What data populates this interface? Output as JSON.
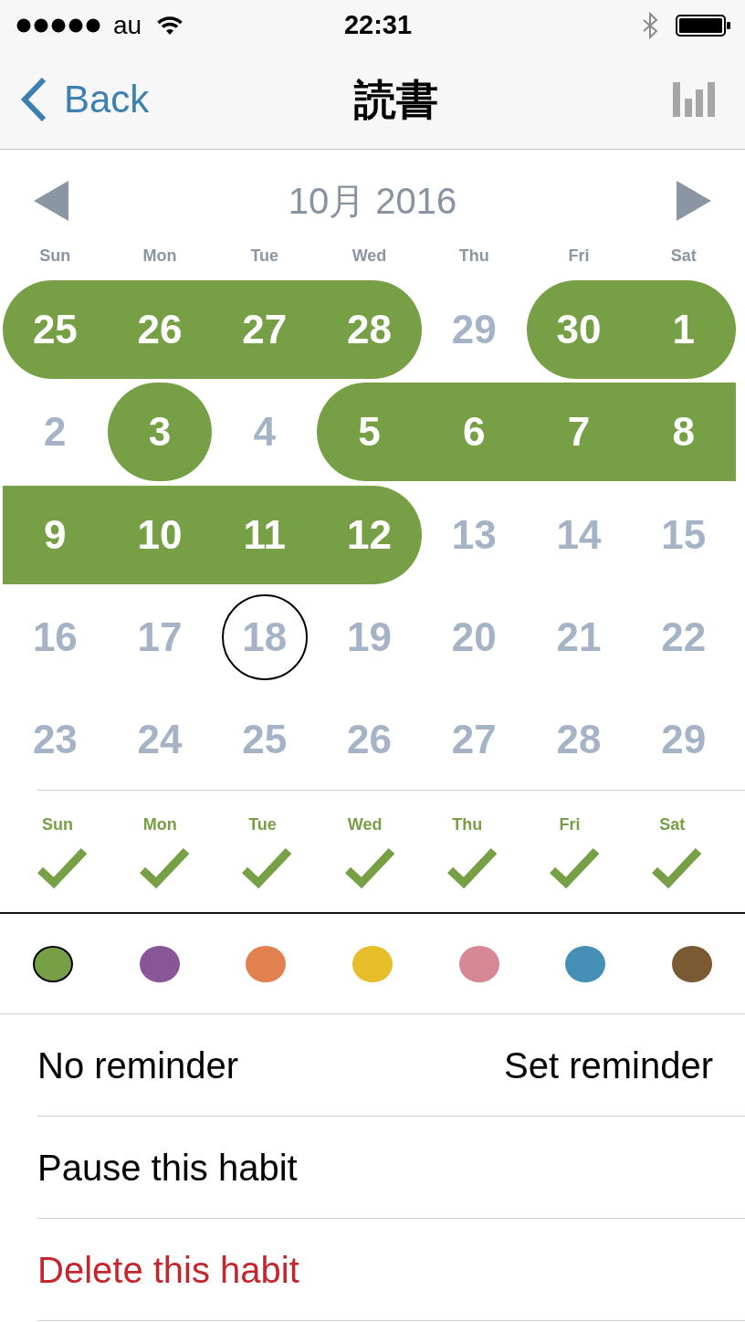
{
  "status_bar": {
    "carrier": "au",
    "time": "22:31"
  },
  "nav_bar": {
    "back_label": "Back",
    "title": "読書"
  },
  "calendar": {
    "month_title": "10月 2016",
    "weekdays": [
      "Sun",
      "Mon",
      "Tue",
      "Wed",
      "Thu",
      "Fri",
      "Sat"
    ],
    "days": [
      {
        "label": "25",
        "done": true,
        "today": false
      },
      {
        "label": "26",
        "done": true,
        "today": false
      },
      {
        "label": "27",
        "done": true,
        "today": false
      },
      {
        "label": "28",
        "done": true,
        "today": false
      },
      {
        "label": "29",
        "done": false,
        "today": false
      },
      {
        "label": "30",
        "done": true,
        "today": false
      },
      {
        "label": "1",
        "done": true,
        "today": false
      },
      {
        "label": "2",
        "done": false,
        "today": false
      },
      {
        "label": "3",
        "done": true,
        "today": false
      },
      {
        "label": "4",
        "done": false,
        "today": false
      },
      {
        "label": "5",
        "done": true,
        "today": false
      },
      {
        "label": "6",
        "done": true,
        "today": false
      },
      {
        "label": "7",
        "done": true,
        "today": false
      },
      {
        "label": "8",
        "done": true,
        "today": false
      },
      {
        "label": "9",
        "done": true,
        "today": false
      },
      {
        "label": "10",
        "done": true,
        "today": false
      },
      {
        "label": "11",
        "done": true,
        "today": false
      },
      {
        "label": "12",
        "done": true,
        "today": false
      },
      {
        "label": "13",
        "done": false,
        "today": false
      },
      {
        "label": "14",
        "done": false,
        "today": false
      },
      {
        "label": "15",
        "done": false,
        "today": false
      },
      {
        "label": "16",
        "done": false,
        "today": false
      },
      {
        "label": "17",
        "done": false,
        "today": false
      },
      {
        "label": "18",
        "done": false,
        "today": true
      },
      {
        "label": "19",
        "done": false,
        "today": false
      },
      {
        "label": "20",
        "done": false,
        "today": false
      },
      {
        "label": "21",
        "done": false,
        "today": false
      },
      {
        "label": "22",
        "done": false,
        "today": false
      },
      {
        "label": "23",
        "done": false,
        "today": false
      },
      {
        "label": "24",
        "done": false,
        "today": false
      },
      {
        "label": "25",
        "done": false,
        "today": false
      },
      {
        "label": "26",
        "done": false,
        "today": false
      },
      {
        "label": "27",
        "done": false,
        "today": false
      },
      {
        "label": "28",
        "done": false,
        "today": false
      },
      {
        "label": "29",
        "done": false,
        "today": false
      }
    ]
  },
  "schedule": [
    {
      "label": "Sun",
      "checked": true
    },
    {
      "label": "Mon",
      "checked": true
    },
    {
      "label": "Tue",
      "checked": true
    },
    {
      "label": "Wed",
      "checked": true
    },
    {
      "label": "Thu",
      "checked": true
    },
    {
      "label": "Fri",
      "checked": true
    },
    {
      "label": "Sat",
      "checked": true
    }
  ],
  "colors": [
    {
      "color": "#77a046",
      "selected": true
    },
    {
      "color": "#8a5596",
      "selected": false
    },
    {
      "color": "#e3804f",
      "selected": false
    },
    {
      "color": "#e6be2c",
      "selected": false
    },
    {
      "color": "#d58893",
      "selected": false
    },
    {
      "color": "#4690b6",
      "selected": false
    },
    {
      "color": "#7a5a32",
      "selected": false
    }
  ],
  "reminder": {
    "label": "No reminder",
    "action": "Set reminder"
  },
  "actions": [
    {
      "label": "Pause this habit",
      "kind": "normal"
    },
    {
      "label": "Delete this habit",
      "kind": "destructive"
    }
  ]
}
